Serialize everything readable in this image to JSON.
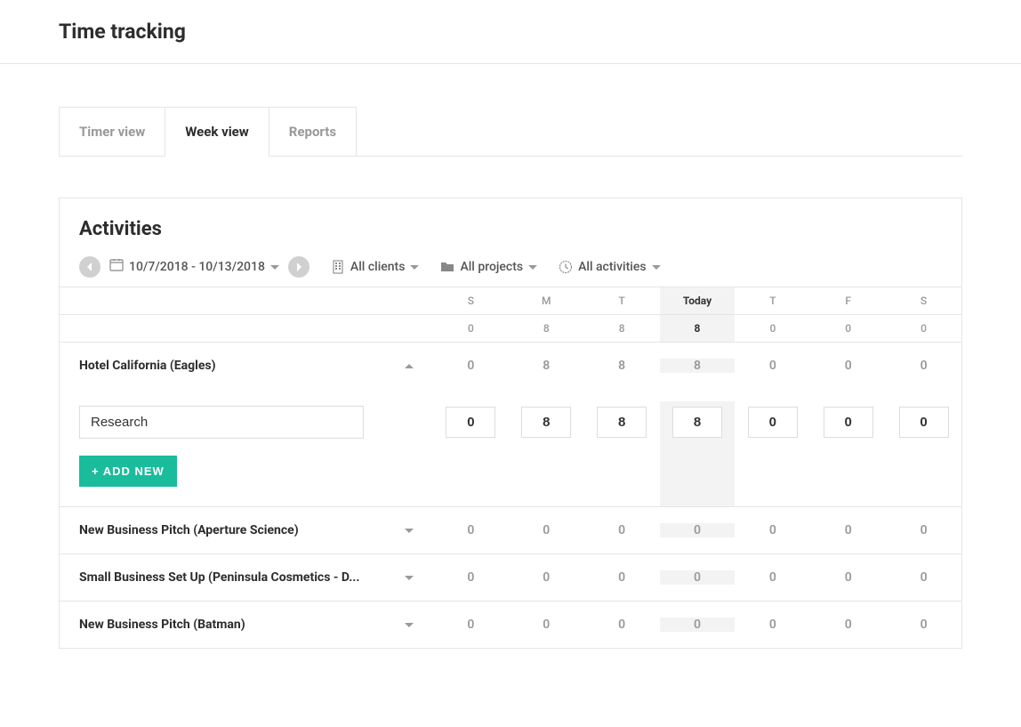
{
  "page_title": "Time tracking",
  "tabs": {
    "timer_view": "Timer view",
    "week_view": "Week view",
    "reports": "Reports"
  },
  "panel": {
    "title": "Activities",
    "date_range": "10/7/2018 - 10/13/2018",
    "filters": {
      "clients": "All clients",
      "projects": "All projects",
      "activities": "All activities"
    }
  },
  "days": [
    "S",
    "M",
    "T",
    "Today",
    "T",
    "F",
    "S"
  ],
  "totals_row": [
    "0",
    "8",
    "8",
    "8",
    "0",
    "0",
    "0"
  ],
  "projects": [
    {
      "name": "Hotel California (Eagles)",
      "expanded": true,
      "totals": [
        "0",
        "8",
        "8",
        "8",
        "0",
        "0",
        "0"
      ],
      "activity": {
        "name": "Research",
        "hours": [
          "0",
          "8",
          "8",
          "8",
          "0",
          "0",
          "0"
        ]
      }
    },
    {
      "name": "New Business Pitch (Aperture Science)",
      "expanded": false,
      "totals": [
        "0",
        "0",
        "0",
        "0",
        "0",
        "0",
        "0"
      ]
    },
    {
      "name": "Small Business Set Up (Peninsula Cosmetics - D...",
      "expanded": false,
      "totals": [
        "0",
        "0",
        "0",
        "0",
        "0",
        "0",
        "0"
      ]
    },
    {
      "name": "New Business Pitch (Batman)",
      "expanded": false,
      "totals": [
        "0",
        "0",
        "0",
        "0",
        "0",
        "0",
        "0"
      ]
    }
  ],
  "add_new_label": "+ ADD NEW"
}
